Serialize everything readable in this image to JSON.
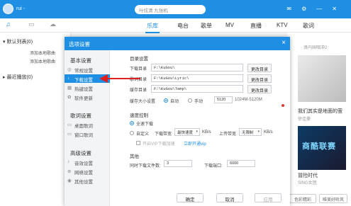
{
  "app": {
    "user": "rui -",
    "search_placeholder": "叶炫清 九张机",
    "nav_tabs": [
      "乐库",
      "电台",
      "歌单",
      "MV",
      "直播",
      "KTV",
      "歌词"
    ]
  },
  "left_panel": {
    "default_list": "默认列表",
    "default_count": "(0)",
    "add_local_1": "添加本地歌曲",
    "add_local_2": "添加本地歌曲",
    "recent": "最近播放",
    "recent_count": "(0)"
  },
  "right_panel": {
    "label_top": "贤内国咽冲2",
    "cover1_title": "我们其实是地面的萤",
    "cover1_sub": "徐佳豪",
    "cover2_text": "商酷联赛",
    "cover2_title": "冒险时代",
    "cover2_sub": "SING女团",
    "btn_left": "色彩精彩",
    "btn_right": "唯美好听风"
  },
  "dialog": {
    "title": "选项设置",
    "close": "×",
    "nav": {
      "group1": "基本设置",
      "items1": [
        {
          "icon": "◎",
          "label": "常规设置"
        },
        {
          "icon": "↓",
          "label": "下载设置"
        },
        {
          "icon": "▦",
          "label": "热键设置"
        },
        {
          "icon": "✿",
          "label": "软件更新"
        }
      ],
      "group2": "歌词设置",
      "items2": [
        {
          "icon": "▭",
          "label": "桌面歌词"
        },
        {
          "icon": "▭",
          "label": "窗口歌词"
        }
      ],
      "group3": "高级设置",
      "items3": [
        {
          "icon": "♪",
          "label": "音效设置"
        },
        {
          "icon": "⊕",
          "label": "网络设置"
        },
        {
          "icon": "◉",
          "label": "其他设置"
        }
      ]
    },
    "dir_section": {
      "title": "目录设置",
      "download_label": "下载目录",
      "download_path": "F:\\KuGou\\",
      "lyric_label": "歌词目录",
      "lyric_path": "F:\\KuGou\\Lyric\\",
      "cache_label": "缓存目录",
      "cache_path": "F:\\KuGou\\Temp\\",
      "change_btn": "更改目录",
      "cache_size_label": "缓存大小设置",
      "auto": "自动",
      "manual": "手动",
      "size_value": "5120",
      "size_range": "1024M-5120M"
    },
    "speed_section": {
      "title": "速度控制",
      "full": "全速下载",
      "custom": "自定义",
      "down_label": "下载带宽",
      "down_value": "最快速度",
      "unit1": "KB/s",
      "up_label": "上传带宽",
      "up_value": "无限制",
      "unit2": "KB/s",
      "vip_label": "开启VIP下载加速",
      "vip_link": "立即开通vip"
    },
    "other_section": {
      "title": "其他",
      "concurrent_label": "同时下载文件数:",
      "concurrent_value": "3",
      "port_label": "下载端口:",
      "port_value": "6000"
    },
    "buttons": {
      "ok": "确定",
      "cancel": "取消",
      "apply": "应用"
    }
  }
}
